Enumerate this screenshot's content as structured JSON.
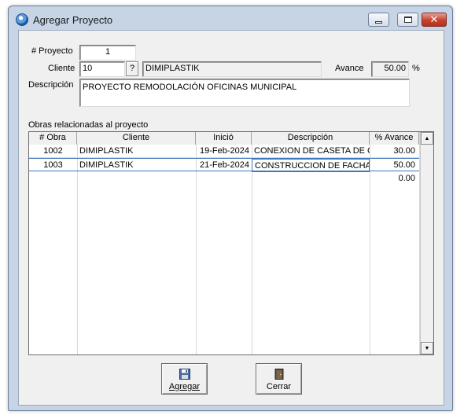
{
  "window": {
    "title": "Agregar Proyecto"
  },
  "form": {
    "proyecto_label": "# Proyecto",
    "proyecto_value": "1",
    "cliente_label": "Cliente",
    "cliente_id": "10",
    "cliente_lookup": "?",
    "cliente_name": "DIMIPLASTIK",
    "avance_label": "Avance",
    "avance_value": "50.00",
    "avance_unit": "%",
    "descripcion_label": "Descripción",
    "descripcion_value": "PROYECTO REMODOLACIÓN OFICINAS MUNICIPAL"
  },
  "grid": {
    "caption": "Obras relacionadas al proyecto",
    "columns": [
      "# Obra",
      "Cliente",
      "Inició",
      "Descripción",
      "% Avance"
    ],
    "rows": [
      {
        "obra": "1002",
        "cliente": "DIMIPLASTIK",
        "inicio": "19-Feb-2024",
        "descripcion": "CONEXION DE CASETA DE CO",
        "avance": "30.00"
      },
      {
        "obra": "1003",
        "cliente": "DIMIPLASTIK",
        "inicio": "21-Feb-2024",
        "descripcion": "CONSTRUCCION DE FACHADA",
        "avance": "50.00"
      }
    ],
    "total": "0.00"
  },
  "buttons": {
    "agregar": "Agregar",
    "cerrar": "Cerrar"
  }
}
